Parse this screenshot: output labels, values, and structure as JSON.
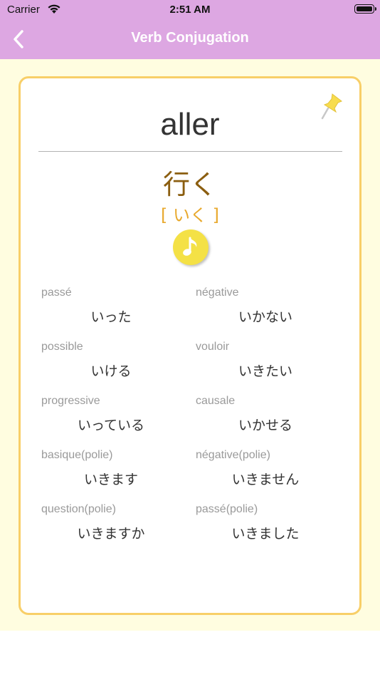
{
  "status_bar": {
    "carrier": "Carrier",
    "time": "2:51 AM"
  },
  "nav": {
    "title": "Verb Conjugation"
  },
  "card": {
    "word": "aller",
    "kanji": "行く",
    "kana": "[ いく ]"
  },
  "conjugations": [
    {
      "label": "passé",
      "value": "いった"
    },
    {
      "label": "négative",
      "value": "いかない"
    },
    {
      "label": "possible",
      "value": "いける"
    },
    {
      "label": "vouloir",
      "value": "いきたい"
    },
    {
      "label": "progressive",
      "value": "いっている"
    },
    {
      "label": "causale",
      "value": "いかせる"
    },
    {
      "label": "basique(polie)",
      "value": "いきます"
    },
    {
      "label": "négative(polie)",
      "value": "いきません"
    },
    {
      "label": "question(polie)",
      "value": "いきますか"
    },
    {
      "label": "passé(polie)",
      "value": "いきました"
    }
  ],
  "colors": {
    "header": "#dda7e2",
    "background": "#fffde0",
    "card_border": "#f8cf68",
    "kanji": "#8b5e10",
    "kana": "#e8a92e",
    "audio_button": "#f4e146"
  },
  "icons": [
    "back-chevron-icon",
    "wifi-icon",
    "battery-icon",
    "pin-icon",
    "music-note-icon"
  ]
}
